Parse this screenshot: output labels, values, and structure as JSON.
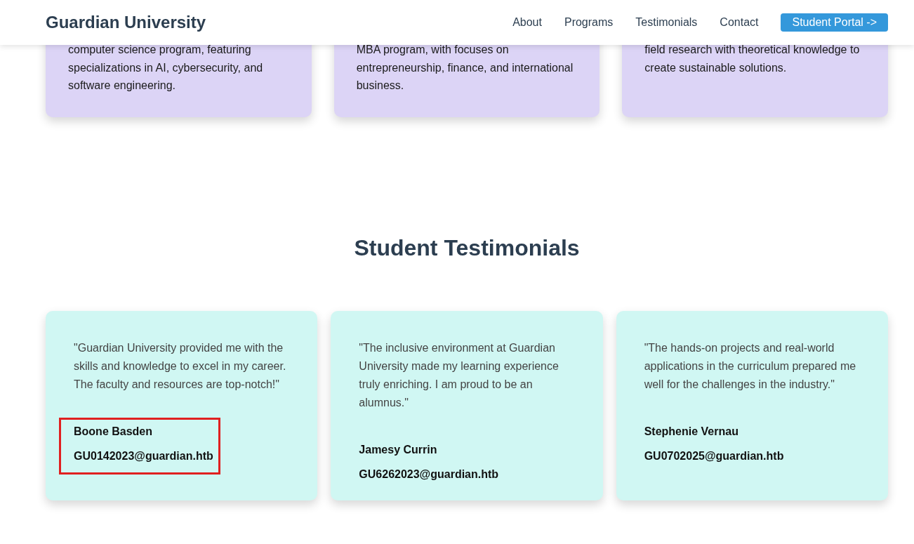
{
  "header": {
    "title": "Guardian University",
    "nav": [
      {
        "label": "About",
        "kind": "link"
      },
      {
        "label": "Programs",
        "kind": "link"
      },
      {
        "label": "Testimonials",
        "kind": "link"
      },
      {
        "label": "Contact",
        "kind": "link"
      },
      {
        "label": "Student Portal ->",
        "kind": "button"
      }
    ]
  },
  "programs": [
    {
      "description": "computer science program, featuring specializations in AI, cybersecurity, and software engineering."
    },
    {
      "description": "MBA program, with focuses on entrepreneurship, finance, and international business."
    },
    {
      "description": "field research with theoretical knowledge to create sustainable solutions."
    }
  ],
  "testimonials": {
    "heading": "Student Testimonials",
    "items": [
      {
        "quote": "\"Guardian University provided me with the skills and knowledge to excel in my career. The faculty and resources are top-notch!\"",
        "name": "Boone Basden",
        "email": "GU0142023@guardian.htb",
        "highlighted": true
      },
      {
        "quote": "\"The inclusive environment at Guardian University made my learning experience truly enriching. I am proud to be an alumnus.\"",
        "name": "Jamesy Currin",
        "email": "GU6262023@guardian.htb",
        "highlighted": false
      },
      {
        "quote": "\"The hands-on projects and real-world applications in the curriculum prepared me well for the challenges in the industry.\"",
        "name": "Stephenie Vernau",
        "email": "GU0702025@guardian.htb",
        "highlighted": false
      }
    ]
  }
}
